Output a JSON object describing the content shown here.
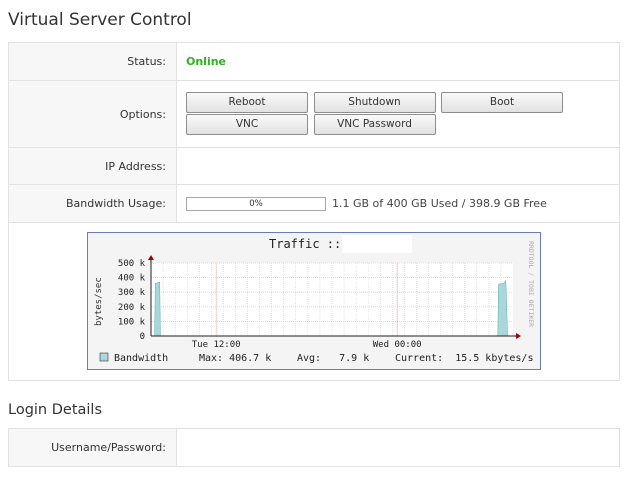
{
  "page": {
    "title": "Virtual Server Control"
  },
  "status": {
    "label": "Status:",
    "value": "Online",
    "color": "#2cb41e"
  },
  "options": {
    "label": "Options:",
    "buttons": {
      "reboot": "Reboot",
      "shutdown": "Shutdown",
      "boot": "Boot",
      "vnc": "VNC",
      "vnc_password": "VNC Password"
    }
  },
  "ip": {
    "label": "IP Address:",
    "value": ""
  },
  "bandwidth": {
    "label": "Bandwidth Usage:",
    "percent_text": "0%",
    "percent": 0,
    "summary": "1.1 GB of 400 GB Used / 398.9 GB Free"
  },
  "graph": {
    "title": "Traffic ::",
    "ylabel": "bytes/sec",
    "watermark": "RRDTOOL / TOBI OETIKER",
    "legend": {
      "series": "Bandwidth",
      "max": "Max: 406.7 k",
      "avg": "Avg:   7.9 k",
      "current": "Current:  15.5 kbytes/s"
    }
  },
  "chart_data": {
    "type": "area",
    "title": "Traffic ::",
    "ylabel": "bytes/sec",
    "yticks": [
      "0",
      "100 k",
      "200 k",
      "300 k",
      "400 k",
      "500 k"
    ],
    "ylim": [
      0,
      500000
    ],
    "xticks": [
      "Tue 12:00",
      "Wed 00:00"
    ],
    "grid": true,
    "series": [
      {
        "name": "Bandwidth",
        "color": "#a9d8dc",
        "points": [
          {
            "x": 0.0,
            "y": 0
          },
          {
            "x": 0.01,
            "y": 0
          },
          {
            "x": 0.012,
            "y": 360000
          },
          {
            "x": 0.024,
            "y": 370000
          },
          {
            "x": 0.026,
            "y": 0
          },
          {
            "x": 0.958,
            "y": 0
          },
          {
            "x": 0.96,
            "y": 355000
          },
          {
            "x": 0.975,
            "y": 360000
          },
          {
            "x": 0.98,
            "y": 380000
          },
          {
            "x": 0.985,
            "y": 0
          },
          {
            "x": 1.0,
            "y": 0
          }
        ]
      }
    ]
  },
  "login": {
    "title": "Login Details",
    "label": "Username/Password:",
    "value": ""
  }
}
